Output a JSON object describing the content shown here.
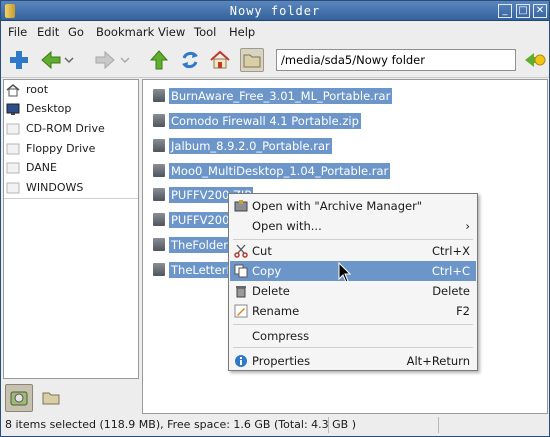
{
  "window": {
    "title": "Nowy folder"
  },
  "menubar": [
    "File",
    "Edit",
    "Go",
    "Bookmark",
    "View",
    "Tool",
    "Help"
  ],
  "toolbar": {
    "location": "/media/sda5/Nowy folder"
  },
  "sidebar": {
    "items": [
      {
        "label": "root",
        "icon": "home-icon"
      },
      {
        "label": "Desktop",
        "icon": "desktop-icon"
      },
      {
        "label": "CD-ROM Drive",
        "icon": "drive-icon"
      },
      {
        "label": "Floppy Drive",
        "icon": "drive-icon"
      },
      {
        "label": "DANE",
        "icon": "drive-icon"
      },
      {
        "label": "WINDOWS",
        "icon": "drive-icon"
      }
    ]
  },
  "files": [
    "BurnAware_Free_3.01_ML_Portable.rar",
    "Comodo Firewall 4.1 Portable.zip",
    "Jalbum_8.9.2.0_Portable.rar",
    "Moo0_MultiDesktop_1.04_Portable.rar",
    "PUFFV200.ZIP",
    "PUFFV200H",
    "TheFolderS",
    "TheLetterEr"
  ],
  "context_menu": {
    "items": [
      {
        "label": "Open with \"Archive Manager\"",
        "shortcut": ""
      },
      {
        "label": "Open with...",
        "shortcut": ""
      },
      {
        "label": "Cut",
        "shortcut": "Ctrl+X"
      },
      {
        "label": "Copy",
        "shortcut": "Ctrl+C"
      },
      {
        "label": "Delete",
        "shortcut": "Delete"
      },
      {
        "label": "Rename",
        "shortcut": "F2"
      },
      {
        "label": "Compress",
        "shortcut": ""
      },
      {
        "label": "Properties",
        "shortcut": "Alt+Return"
      }
    ]
  },
  "status": "8 items selected (118.9 MB), Free space: 1.6 GB (Total: 4.3 GB )",
  "colors": {
    "selection": "#6c96c9",
    "titlebar": "#4673ad"
  }
}
